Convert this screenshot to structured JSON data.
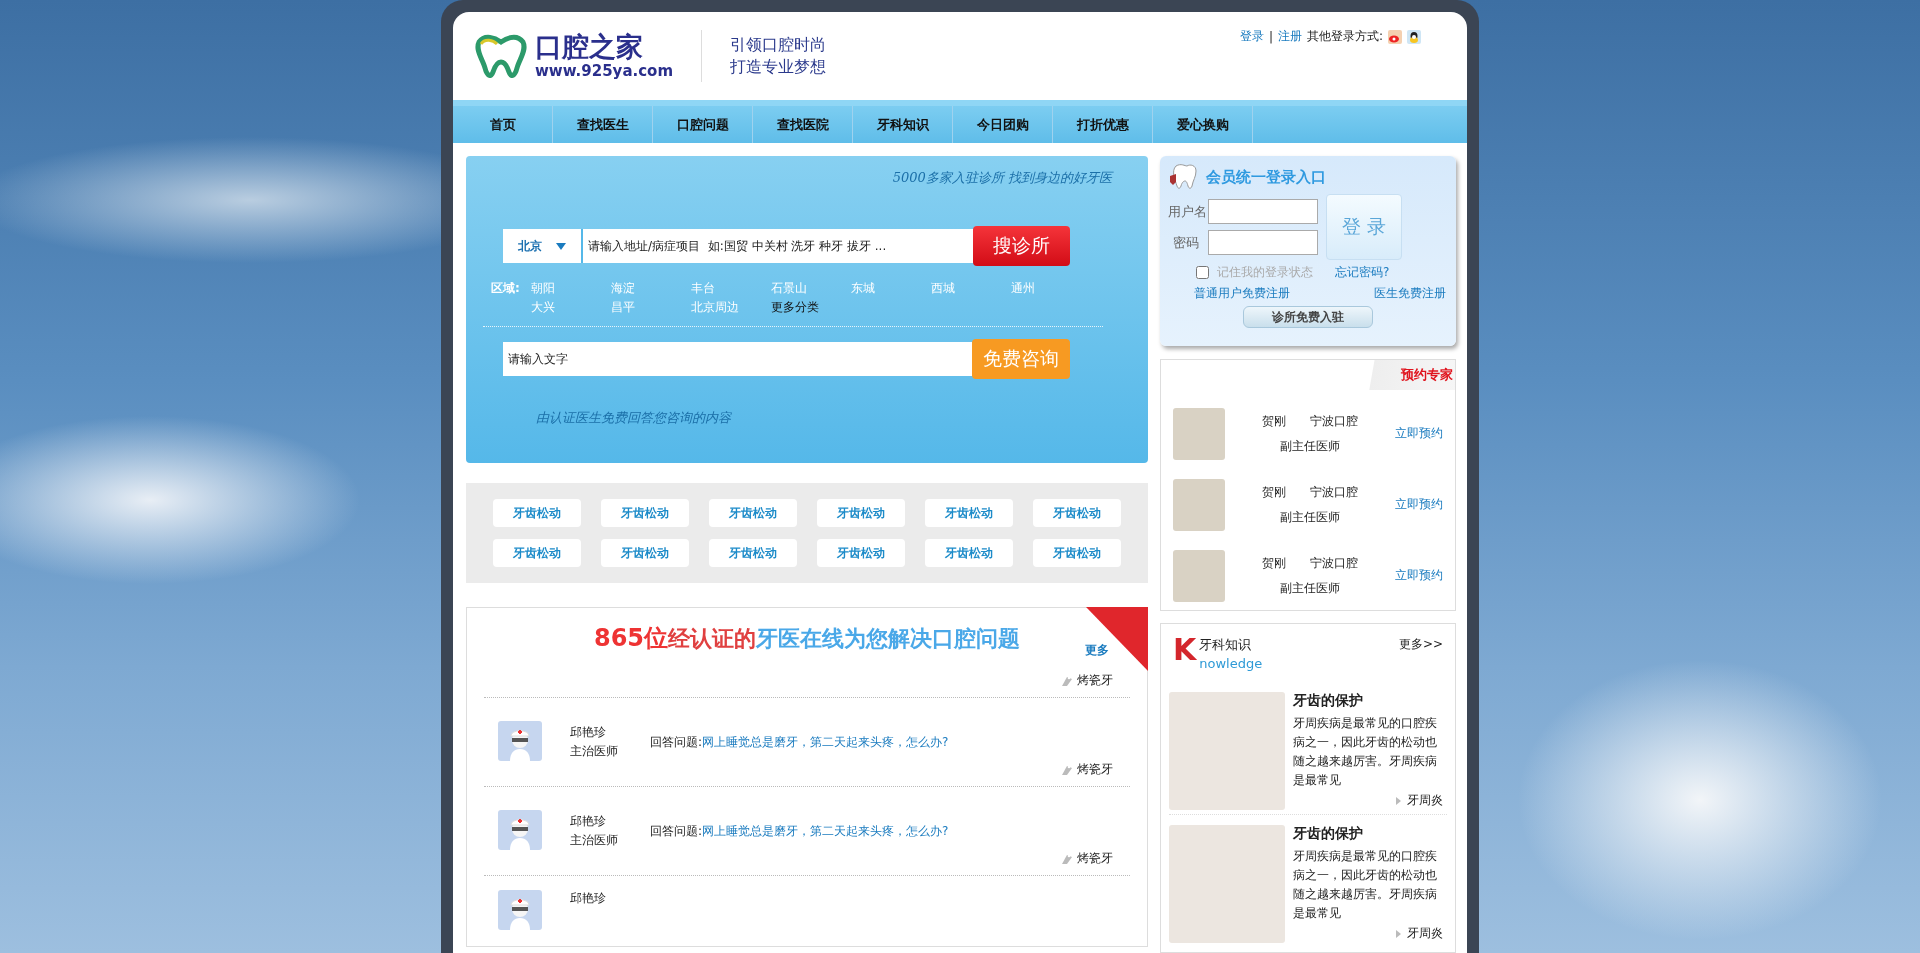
{
  "header": {
    "logo_name": "口腔之家",
    "logo_url": "www.925ya.com",
    "slogan": [
      "引领口腔时尚",
      "打造专业梦想"
    ],
    "login_link": "登录",
    "separator": "|",
    "register_link": "注册",
    "other_login_label": "其他登录方式:"
  },
  "nav": [
    "首页",
    "查找医生",
    "口腔问题",
    "查找医院",
    "牙科知识",
    "今日团购",
    "打折优惠",
    "爱心换购"
  ],
  "search": {
    "tagline": "5000多家入驻诊所   找到身边的好牙医",
    "city": "北京",
    "placeholder": "请输入地址/病症项目  如:国贸 中关村 洗牙 种牙 拔牙 ...",
    "button": "搜诊所",
    "area_label": "区域:",
    "areas": [
      {
        "label": "朝阳",
        "kind": "district"
      },
      {
        "label": "海淀",
        "kind": "district"
      },
      {
        "label": "丰台",
        "kind": "district"
      },
      {
        "label": "石景山",
        "kind": "district"
      },
      {
        "label": "东城",
        "kind": "district"
      },
      {
        "label": "西城",
        "kind": "district"
      },
      {
        "label": "通州",
        "kind": "district"
      },
      {
        "label": "大兴",
        "kind": "district"
      },
      {
        "label": "昌平",
        "kind": "district"
      },
      {
        "label": "北京周边",
        "kind": "district"
      },
      {
        "label": "更多分类",
        "kind": "more"
      }
    ],
    "consult_placeholder": "请输入文字",
    "consult_button": "免费咨询",
    "note": "由认证医生免费回答您咨询的内容"
  },
  "tags": [
    "牙齿松动",
    "牙齿松动",
    "牙齿松动",
    "牙齿松动",
    "牙齿松动",
    "牙齿松动",
    "牙齿松动",
    "牙齿松动",
    "牙齿松动",
    "牙齿松动",
    "牙齿松动",
    "牙齿松动"
  ],
  "qa": {
    "heading_number": "865位",
    "heading_certified": "经认证的",
    "heading_rest": "牙医在线为您解决口腔问题",
    "more": "更多",
    "rows": [
      {
        "tag": "烤瓷牙"
      },
      {
        "name": "邱艳珍",
        "title": "主治医师",
        "label": "回答问题:",
        "question": "网上睡觉总是磨牙，第二天起来头疼，怎么办?",
        "tag": "烤瓷牙"
      },
      {
        "name": "邱艳珍",
        "title": "主治医师",
        "label": "回答问题:",
        "question": "网上睡觉总是磨牙，第二天起来头疼，怎么办?",
        "tag": "烤瓷牙"
      },
      {
        "name": "邱艳珍"
      }
    ]
  },
  "login": {
    "title": "会员统一登录入口",
    "username_label": "用户名",
    "password_label": "密码",
    "button": "登 录",
    "remember": {
      "label": "记住我的登录状态",
      "checked": false
    },
    "forgot": "忘记密码?",
    "user_register": "普通用户免费注册",
    "doctor_register": "医生免费注册",
    "clinic_button": "诊所免费入驻"
  },
  "experts": {
    "title": "预约专家",
    "items": [
      {
        "name": "贺刚",
        "hospital": "宁波口腔",
        "title": "副主任医师",
        "action": "立即预约"
      },
      {
        "name": "贺刚",
        "hospital": "宁波口腔",
        "title": "副主任医师",
        "action": "立即预约"
      },
      {
        "name": "贺刚",
        "hospital": "宁波口腔",
        "title": "副主任医师",
        "action": "立即预约"
      }
    ]
  },
  "knowledge": {
    "letter": "K",
    "title": "牙科知识",
    "subtitle": "nowledge",
    "more": "更多>>",
    "articles": [
      {
        "title": "牙齿的保护",
        "text": "牙周疾病是最常见的口腔疾病之一，因此牙齿的松动也随之越来越厉害。牙周疾病是最常见",
        "tag": "牙周炎"
      },
      {
        "title": "牙齿的保护",
        "text": "牙周疾病是最常见的口腔疾病之一，因此牙齿的松动也随之越来越厉害。牙周疾病是最常见",
        "tag": "牙周炎"
      }
    ]
  }
}
